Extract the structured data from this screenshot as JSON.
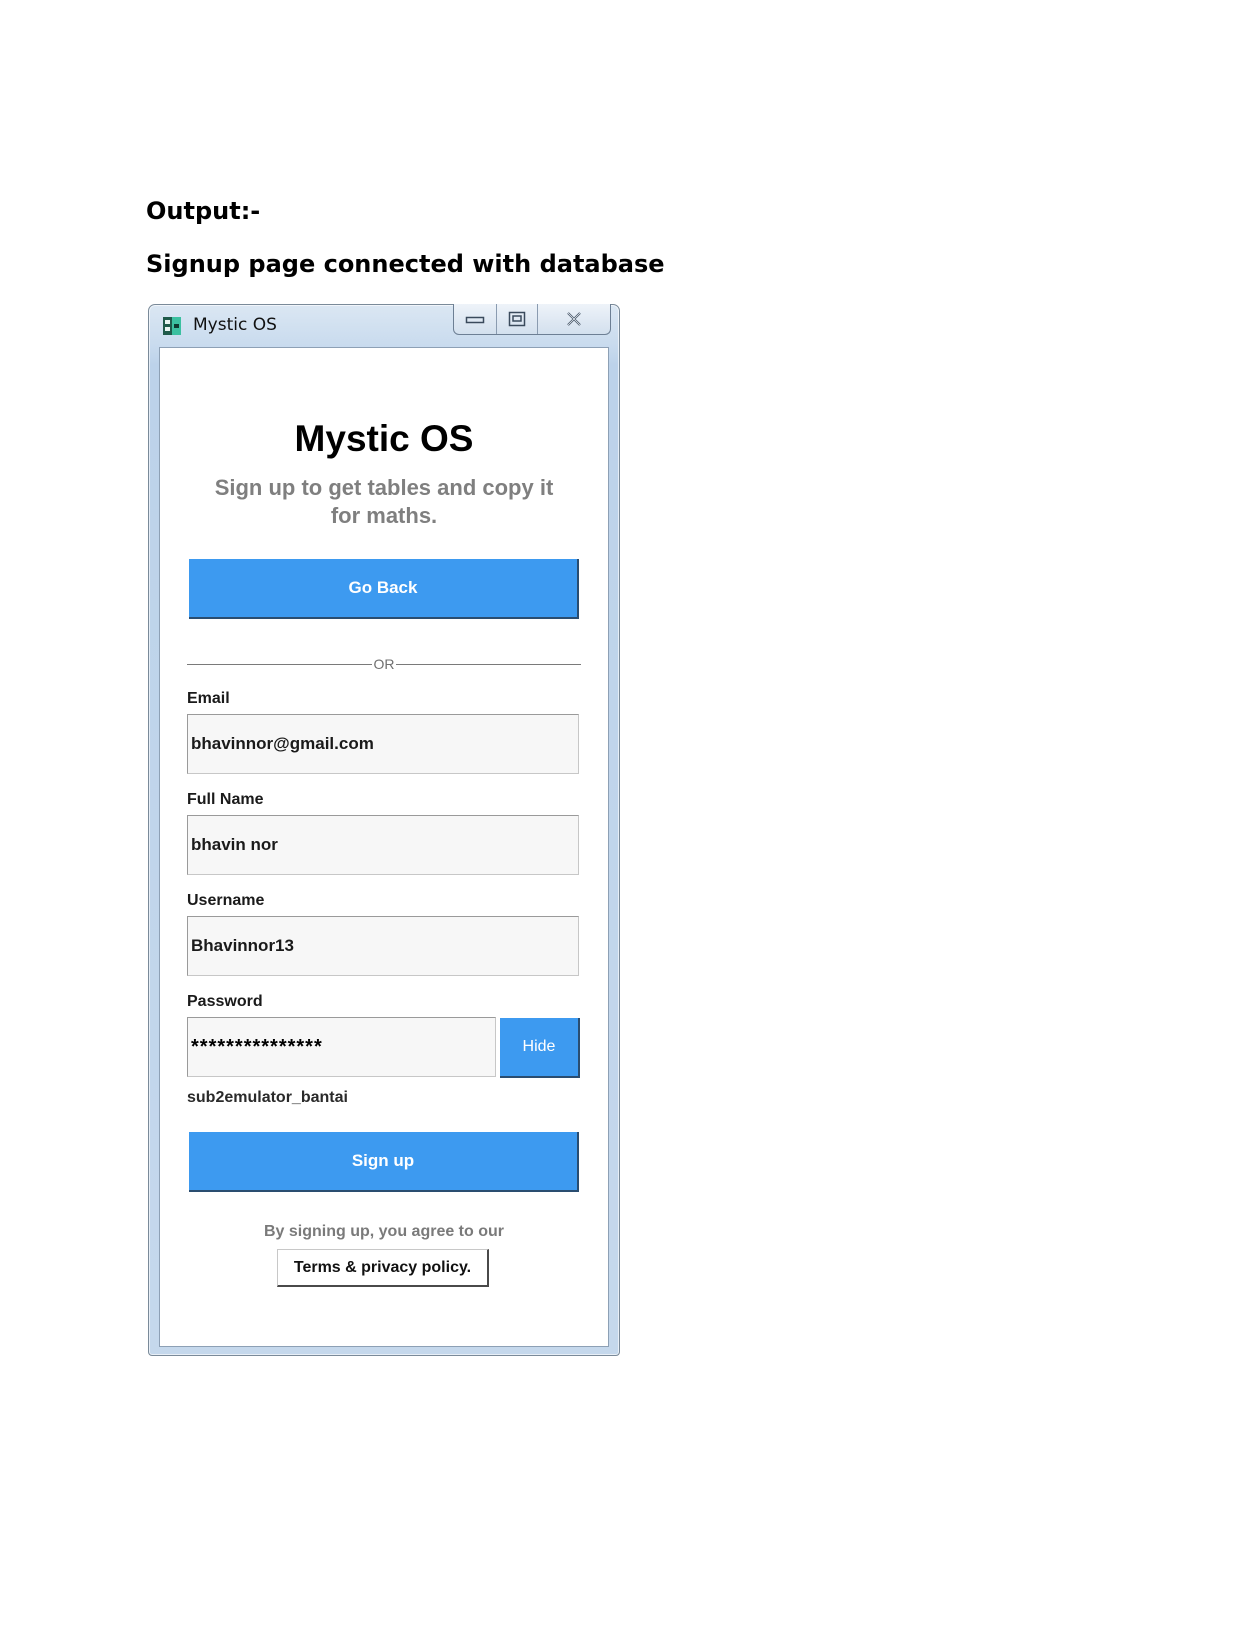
{
  "document": {
    "heading_output": "Output:-",
    "heading_caption": "Signup page connected with database"
  },
  "window": {
    "title": "Mystic OS",
    "icon": "app-icon",
    "controls": [
      "minimize-icon",
      "maximize-icon",
      "close-icon"
    ]
  },
  "app": {
    "title": "Mystic OS",
    "subtitle": "Sign up to get tables and copy it for maths.",
    "go_back_label": "Go Back",
    "divider_text": "OR",
    "fields": {
      "email": {
        "label": "Email",
        "value": "bhavinnor@gmail.com"
      },
      "full_name": {
        "label": "Full Name",
        "value": "bhavin nor"
      },
      "username": {
        "label": "Username",
        "value": "Bhavinnor13"
      },
      "password": {
        "label": "Password",
        "masked_value": "***************"
      }
    },
    "hide_label": "Hide",
    "revealed_password": "sub2emulator_bantai",
    "signup_label": "Sign up",
    "agree_text": "By signing up, you agree to our",
    "terms_label": "Terms & privacy policy."
  },
  "colors": {
    "accent_blue": "#3d9af0",
    "window_frame": "#c9dbee"
  }
}
